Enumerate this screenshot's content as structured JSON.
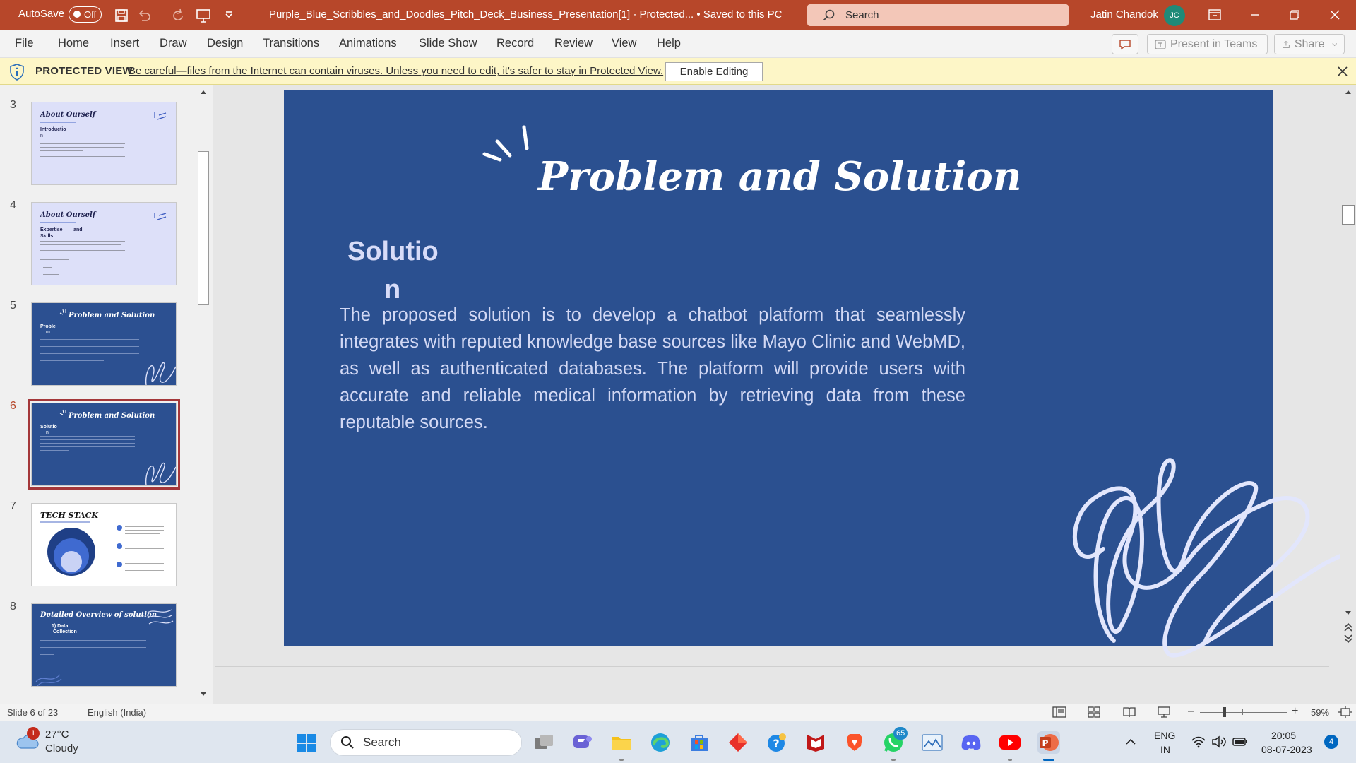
{
  "titlebar": {
    "autosave_label": "AutoSave",
    "autosave_state": "Off",
    "document_title": "Purple_Blue_Scribbles_and_Doodles_Pitch_Deck_Business_Presentation[1]  -  Protected...  •  Saved to this PC",
    "search_placeholder": "Search",
    "user_name": "Jatin Chandok",
    "user_initials": "JC",
    "accent_color": "#b7472a"
  },
  "menu": {
    "items": [
      "File",
      "Home",
      "Insert",
      "Draw",
      "Design",
      "Transitions",
      "Animations",
      "Slide Show",
      "Record",
      "Review",
      "View",
      "Help"
    ],
    "present_label": "Present in Teams",
    "share_label": "Share"
  },
  "protected_view": {
    "title": "PROTECTED VIEW",
    "message": "Be careful—files from the Internet can contain viruses. Unless you need to edit, it's safer to stay in Protected View.",
    "button_label": "Enable Editing"
  },
  "thumbnails": [
    {
      "number": "3",
      "title": "About Ourself",
      "subtitle": "Introductio",
      "subtitle2": "n",
      "style": "light"
    },
    {
      "number": "4",
      "title": "About Ourself",
      "subtitle": "Expertise        and",
      "subtitle2": "Skills",
      "style": "light"
    },
    {
      "number": "5",
      "title": "Problem and Solution",
      "subtitle": "Proble",
      "subtitle2": "m",
      "style": "blue"
    },
    {
      "number": "6",
      "title": "Problem and Solution",
      "subtitle": "Solutio",
      "subtitle2": "n",
      "style": "blue",
      "selected": true
    },
    {
      "number": "7",
      "title": "TECH STACK",
      "subtitle": "",
      "subtitle2": "",
      "style": "white"
    },
    {
      "number": "8",
      "title": "Detailed Overview of solution",
      "subtitle": "1) Data",
      "subtitle2": "Collection",
      "style": "blue"
    }
  ],
  "slide": {
    "title": "Problem and Solution",
    "subheading_part1": "Solutio",
    "subheading_part2": "n",
    "body": "The proposed solution is to develop a chatbot platform that seamlessly integrates with reputed knowledge base sources like Mayo Clinic and WebMD, as well as authenticated databases. The platform will provide users with accurate and reliable medical information by retrieving data from these reputable sources.",
    "background_color": "#2b5090"
  },
  "statusbar": {
    "slide_info": "Slide 6 of 23",
    "language": "English (India)",
    "zoom": "59%"
  },
  "taskbar": {
    "weather_badge": "1",
    "temperature": "27°C",
    "condition": "Cloudy",
    "search_placeholder": "Search",
    "whatsapp_badge": "65",
    "language_line1": "ENG",
    "language_line2": "IN",
    "time": "20:05",
    "date": "08-07-2023",
    "notification_count": "4"
  }
}
